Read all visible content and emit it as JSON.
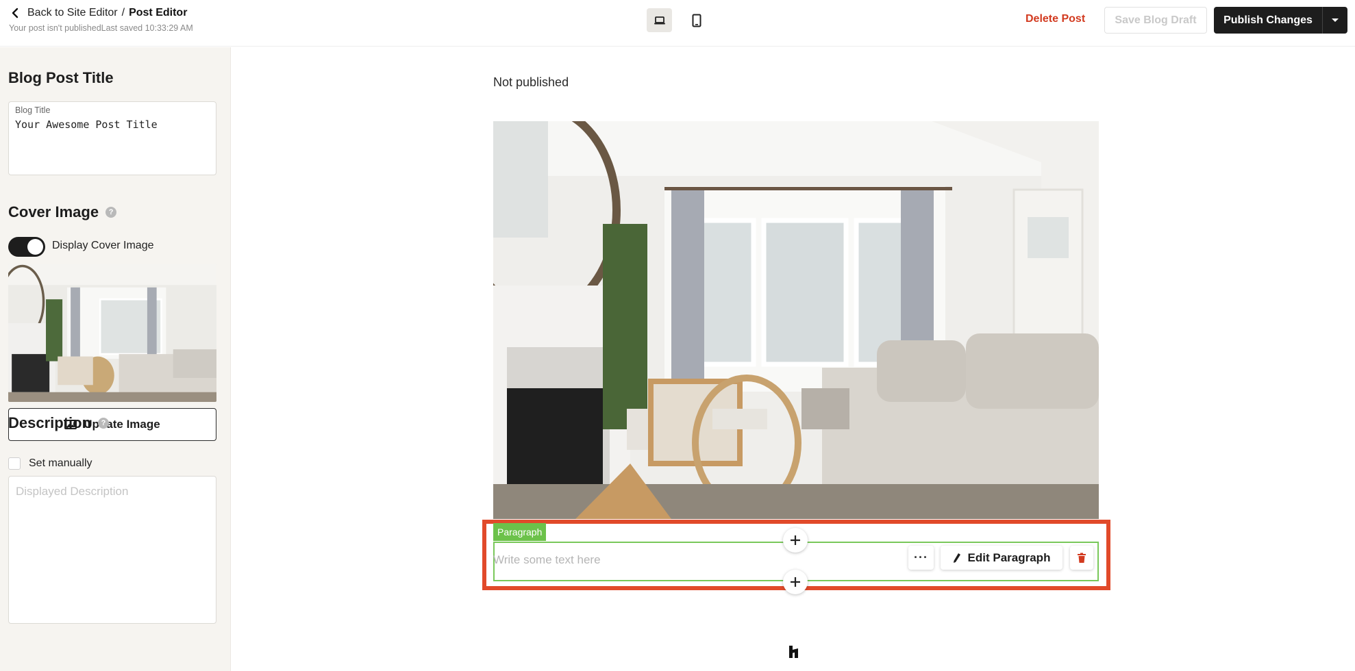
{
  "header": {
    "back_label": "Back to Site Editor",
    "separator": "/",
    "current_page": "Post Editor",
    "status": "Your post isn't publishedLast saved 10:33:29 AM",
    "delete_label": "Delete Post",
    "save_draft_label": "Save Blog Draft",
    "publish_label": "Publish Changes"
  },
  "sidebar": {
    "post_title_heading": "Blog Post Title",
    "title_field": {
      "label": "Blog Title",
      "value": "Your Awesome Post Title"
    },
    "cover_heading": "Cover Image",
    "display_cover_label": "Display Cover Image",
    "display_cover_on": true,
    "update_image_label": "Update Image",
    "description_heading": "Description",
    "set_manually_label": "Set manually",
    "description_placeholder": "Displayed Description"
  },
  "canvas": {
    "publish_state": "Not published",
    "paragraph_tag": "Paragraph",
    "paragraph_placeholder": "Write some text here",
    "more_label": "···",
    "edit_paragraph_label": "Edit Paragraph"
  },
  "colors": {
    "accent_dark": "#1d1d1d",
    "danger": "#d23a1f",
    "selection_outline": "#e14a2a",
    "block_green": "#6cc24a"
  },
  "icons": [
    "chevron-left-icon",
    "laptop-icon",
    "tablet-icon",
    "caret-down-icon",
    "help-icon",
    "image-icon",
    "pencil-icon",
    "trash-icon",
    "plus-icon",
    "brand-logo-icon"
  ]
}
